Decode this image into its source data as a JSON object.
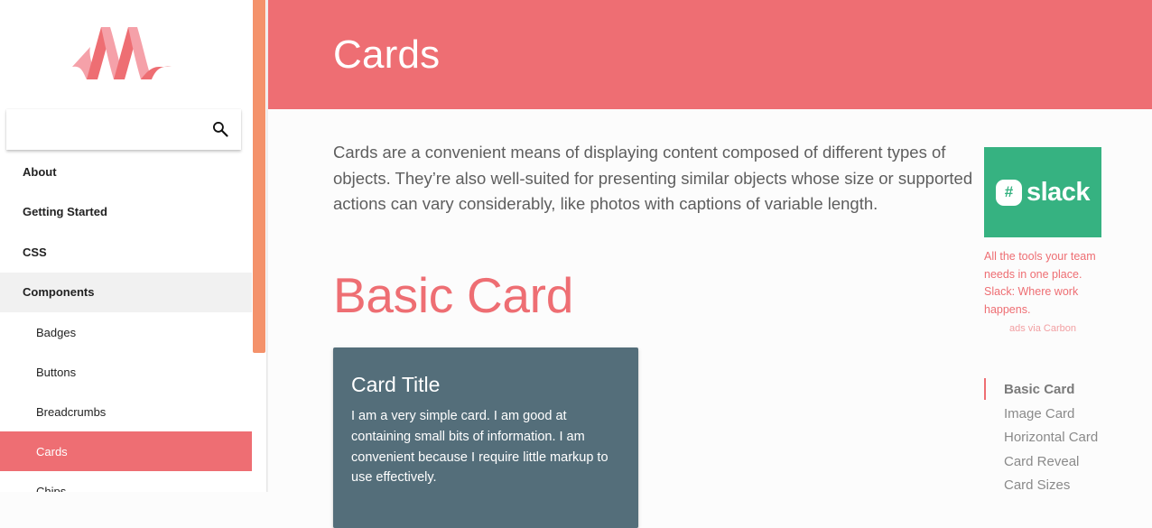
{
  "sidebar": {
    "logo": "materialize-logo",
    "search": {
      "placeholder": "",
      "value": "",
      "icon": "search-icon"
    },
    "nav": [
      {
        "label": "About"
      },
      {
        "label": "Getting Started"
      },
      {
        "label": "CSS"
      },
      {
        "label": "Components",
        "expanded": true
      }
    ],
    "subnav": [
      {
        "label": "Badges"
      },
      {
        "label": "Buttons"
      },
      {
        "label": "Breadcrumbs"
      },
      {
        "label": "Cards",
        "active": true
      },
      {
        "label": "Chips"
      }
    ]
  },
  "header": {
    "title": "Cards"
  },
  "main": {
    "intro": "Cards are a convenient means of displaying content composed of different types of objects. They’re also well-suited for presenting similar objects whose size or supported actions can vary considerably, like photos with captions of variable length.",
    "section_title": "Basic Card",
    "card": {
      "title": "Card Title",
      "text": "I am a very simple card. I am good at containing small bits of information. I am convenient because I require little markup to use effectively."
    }
  },
  "ad": {
    "brand": "slack",
    "mark": "#",
    "text": "All the tools your team needs in one place. Slack: Where work happens.",
    "via": "ads via Carbon"
  },
  "toc": [
    {
      "label": "Basic Card",
      "active": true
    },
    {
      "label": "Image Card"
    },
    {
      "label": "Horizontal Card"
    },
    {
      "label": "Card Reveal"
    },
    {
      "label": "Card Sizes"
    }
  ],
  "colors": {
    "accent": "#ee6e73",
    "scrollbar": "#f4926b",
    "card_bg": "#546e7a",
    "slack_green": "#36b281"
  }
}
